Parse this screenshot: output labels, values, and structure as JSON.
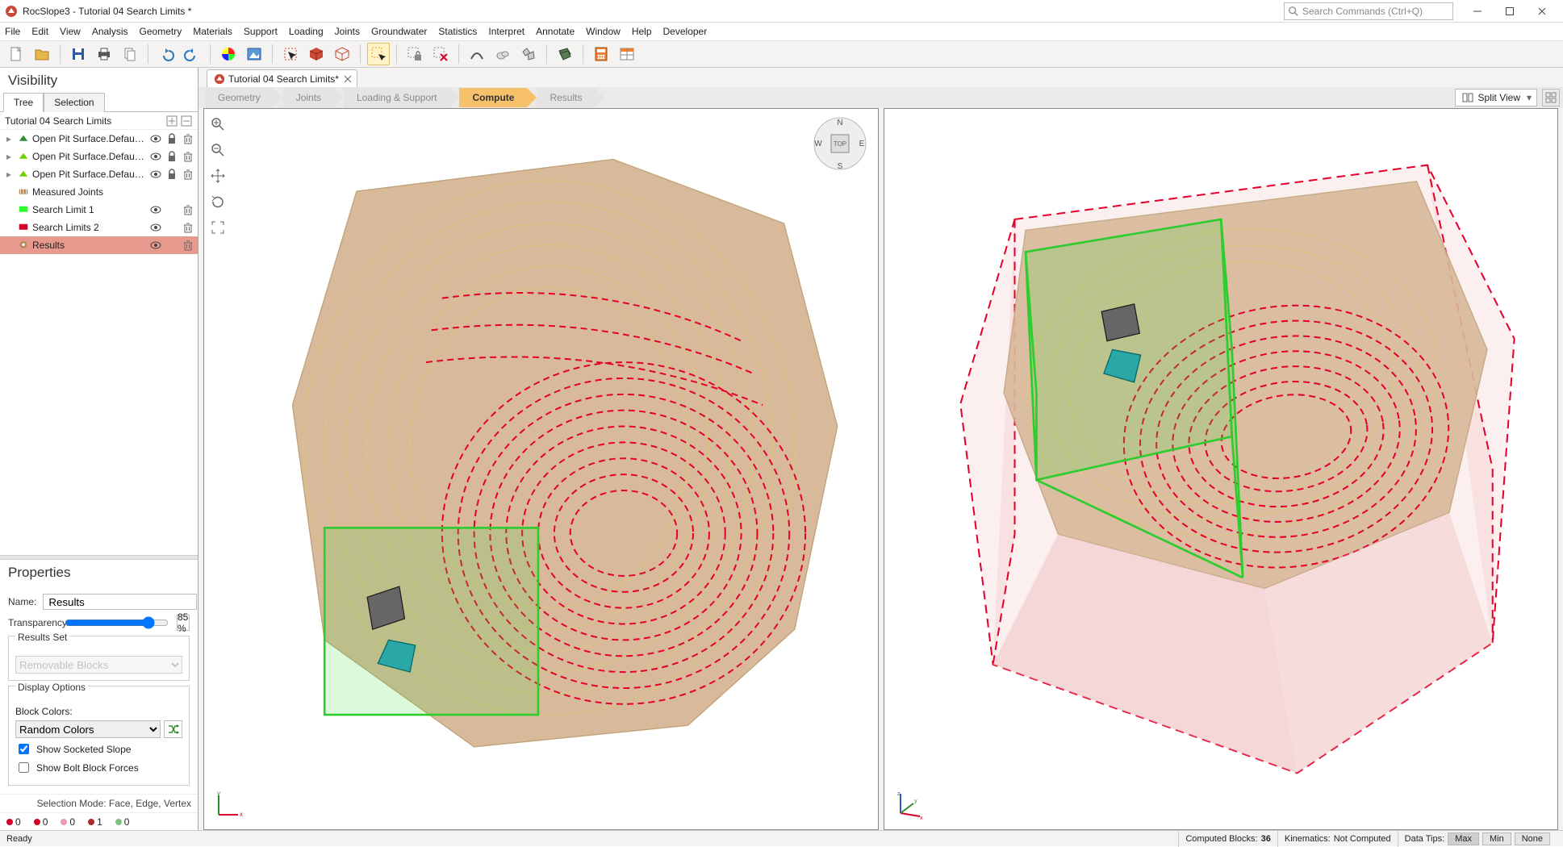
{
  "app": {
    "title": "RocSlope3 - Tutorial 04 Search Limits *",
    "icon": "app-icon"
  },
  "window_controls": {
    "minimize": "—",
    "maximize": "▢",
    "close": "✕"
  },
  "search": {
    "placeholder": "Search Commands (Ctrl+Q)",
    "icon": "search"
  },
  "menubar": [
    "File",
    "Edit",
    "View",
    "Analysis",
    "Geometry",
    "Materials",
    "Support",
    "Loading",
    "Joints",
    "Groundwater",
    "Statistics",
    "Interpret",
    "Annotate",
    "Window",
    "Help",
    "Developer"
  ],
  "toolbar": [
    {
      "name": "new-file",
      "kind": "icon"
    },
    {
      "name": "open-folder",
      "kind": "icon"
    },
    {
      "name": "separator"
    },
    {
      "name": "save",
      "kind": "icon"
    },
    {
      "name": "print",
      "kind": "icon"
    },
    {
      "name": "copy",
      "kind": "icon"
    },
    {
      "name": "separator"
    },
    {
      "name": "undo",
      "kind": "icon"
    },
    {
      "name": "redo",
      "kind": "icon"
    },
    {
      "name": "separator"
    },
    {
      "name": "color-wheel",
      "kind": "icon"
    },
    {
      "name": "image",
      "kind": "icon"
    },
    {
      "name": "separator"
    },
    {
      "name": "select",
      "kind": "icon"
    },
    {
      "name": "cube-solid",
      "kind": "icon"
    },
    {
      "name": "cube-wire",
      "kind": "icon"
    },
    {
      "name": "separator"
    },
    {
      "name": "box-select",
      "kind": "icon",
      "selected": true
    },
    {
      "name": "separator"
    },
    {
      "name": "lock-sel",
      "kind": "icon"
    },
    {
      "name": "clear-sel",
      "kind": "icon"
    },
    {
      "name": "separator"
    },
    {
      "name": "arc",
      "kind": "icon"
    },
    {
      "name": "cloud",
      "kind": "icon"
    },
    {
      "name": "polys",
      "kind": "icon"
    },
    {
      "name": "separator"
    },
    {
      "name": "joint-set",
      "kind": "icon"
    },
    {
      "name": "separator"
    },
    {
      "name": "calc",
      "kind": "icon"
    },
    {
      "name": "table",
      "kind": "icon"
    }
  ],
  "visibility": {
    "title": "Visibility",
    "tabs": [
      {
        "label": "Tree",
        "active": true
      },
      {
        "label": "Selection",
        "active": false
      }
    ],
    "header": {
      "label": "Tutorial 04 Search Limits",
      "icons": [
        "expand-all",
        "collapse-all"
      ]
    },
    "items": [
      {
        "expander": true,
        "color": "#2a8f2a",
        "label": "Open Pit Surface.Default.Mesh_ext",
        "eye": true,
        "lock": true,
        "trash": true,
        "kind": "mesh"
      },
      {
        "expander": true,
        "color": "#6fcf00",
        "label": "Open Pit Surface.Default.Mesh_ext",
        "eye": true,
        "lock": true,
        "trash": true,
        "kind": "mesh"
      },
      {
        "expander": true,
        "color": "#6fcf00",
        "label": "Open Pit Surface.Default.Mesh_ext",
        "eye": true,
        "lock": true,
        "trash": true,
        "kind": "mesh"
      },
      {
        "expander": false,
        "color": "#b88a5a",
        "label": "Measured Joints",
        "eye": false,
        "lock": false,
        "trash": false,
        "kind": "joints"
      },
      {
        "expander": false,
        "color": "#2aff2a",
        "label": "Search Limit 1",
        "eye": true,
        "lock": false,
        "trash": true,
        "kind": "limit"
      },
      {
        "expander": false,
        "color": "#d4002a",
        "label": "Search Limits 2",
        "eye": true,
        "lock": false,
        "trash": true,
        "kind": "limit"
      },
      {
        "expander": false,
        "color": "#b88a5a",
        "label": "Results",
        "eye": true,
        "lock": false,
        "trash": true,
        "kind": "results",
        "selected": true
      }
    ]
  },
  "properties": {
    "title": "Properties",
    "name_label": "Name:",
    "name_value": "Results",
    "transparency_label": "Transparency:",
    "transparency_value": "85 %",
    "results_set": {
      "legend": "Results Set",
      "value": "Removable Blocks"
    },
    "display_options": {
      "legend": "Display Options",
      "block_colors_label": "Block Colors:",
      "block_colors_value": "Random Colors",
      "show_socketed": {
        "label": "Show Socketed Slope",
        "checked": true
      },
      "show_bolt": {
        "label": "Show Bolt Block Forces",
        "checked": false
      }
    },
    "selection_mode": "Selection Mode: Face, Edge, Vertex",
    "counters": [
      {
        "color": "#d4002a",
        "label": "0",
        "icon": "point"
      },
      {
        "color": "#d4002a",
        "label": "0",
        "icon": "line"
      },
      {
        "color": "#e89cb8",
        "label": "0",
        "icon": "poly"
      },
      {
        "color": "#b02828",
        "label": "1",
        "icon": "cube"
      },
      {
        "color": "#7fbf7f",
        "label": "0",
        "icon": "result"
      }
    ]
  },
  "document_tabs": [
    {
      "label": "Tutorial 04 Search Limits*",
      "close": true,
      "icon": "app-icon"
    }
  ],
  "workflow_tabs": [
    {
      "label": "Geometry",
      "active": false
    },
    {
      "label": "Joints",
      "active": false
    },
    {
      "label": "Loading & Support",
      "active": false
    },
    {
      "label": "Compute",
      "active": true
    },
    {
      "label": "Results",
      "active": false
    }
  ],
  "view_dropdown": {
    "label": "Split View",
    "icon": "split-view"
  },
  "viewport": {
    "tools": [
      "zoom-in",
      "zoom-out",
      "pan",
      "rotate",
      "fit"
    ],
    "compass": {
      "n": "N",
      "s": "S",
      "e": "E",
      "w": "W",
      "top": "TOP"
    }
  },
  "statusbar": {
    "left": "Ready",
    "computed_blocks": {
      "label": "Computed Blocks:",
      "value": "36"
    },
    "kinematics": {
      "label": "Kinematics:",
      "value": "Not Computed"
    },
    "data_tips": {
      "label": "Data Tips:",
      "options": [
        "Max",
        "Min",
        "None"
      ],
      "active": "Max"
    }
  }
}
